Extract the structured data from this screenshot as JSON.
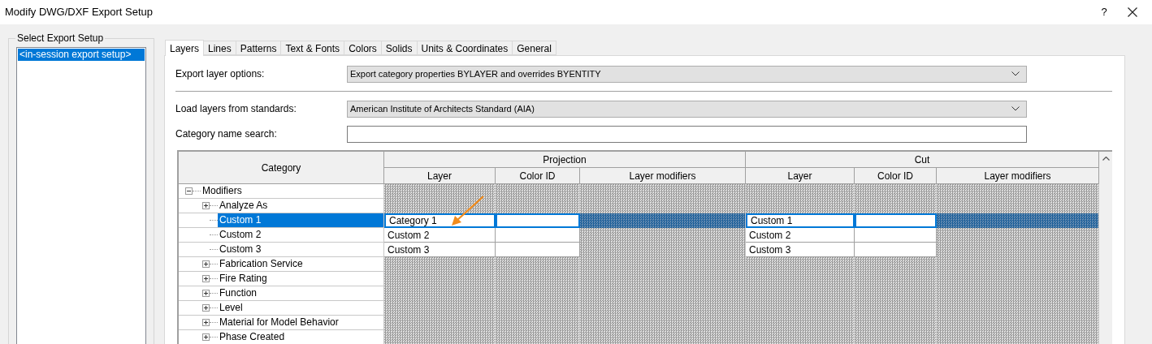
{
  "window": {
    "title": "Modify DWG/DXF Export Setup",
    "help": "?"
  },
  "setups": {
    "label": "Select Export Setup",
    "items": [
      {
        "label": "<in-session export setup>",
        "selected": true
      }
    ]
  },
  "tabs": [
    {
      "label": "Layers",
      "selected": true
    },
    {
      "label": "Lines",
      "selected": false
    },
    {
      "label": "Patterns",
      "selected": false
    },
    {
      "label": "Text & Fonts",
      "selected": false
    },
    {
      "label": "Colors",
      "selected": false
    },
    {
      "label": "Solids",
      "selected": false
    },
    {
      "label": "Units & Coordinates",
      "selected": false
    },
    {
      "label": "General",
      "selected": false
    }
  ],
  "export_layer_options": {
    "label": "Export layer options:",
    "value": "Export category properties BYLAYER and overrides BYENTITY"
  },
  "load_layers": {
    "label": "Load layers from standards:",
    "value": "American Institute of Architects Standard (AIA)"
  },
  "category_search": {
    "label": "Category name search:"
  },
  "table": {
    "category_header": "Category",
    "groups": [
      {
        "title": "Projection",
        "columns": [
          "Layer",
          "Color ID",
          "Layer modifiers"
        ]
      },
      {
        "title": "Cut",
        "columns": [
          "Layer",
          "Color ID",
          "Layer modifiers"
        ]
      }
    ],
    "rows": [
      {
        "name": "Modifiers",
        "expanded": true,
        "selected": false,
        "children": [
          {
            "name": "Analyze As",
            "expanded": false,
            "selected": false
          },
          {
            "name": "Custom 1",
            "selected": true,
            "projection_layer": "Category 1",
            "cut_layer": "Custom 1"
          },
          {
            "name": "Custom 2",
            "selected": false,
            "projection_layer": "Custom 2",
            "cut_layer": "Custom 2"
          },
          {
            "name": "Custom 3",
            "selected": false,
            "projection_layer": "Custom 3",
            "cut_layer": "Custom 3"
          },
          {
            "name": "Fabrication Service",
            "expanded": false,
            "selected": false
          },
          {
            "name": "Fire Rating",
            "expanded": false,
            "selected": false
          },
          {
            "name": "Function",
            "expanded": false,
            "selected": false
          },
          {
            "name": "Level",
            "expanded": false,
            "selected": false
          },
          {
            "name": "Material for Model Behavior",
            "expanded": false,
            "selected": false
          },
          {
            "name": "Phase Created",
            "expanded": false,
            "selected": false
          }
        ]
      }
    ]
  }
}
